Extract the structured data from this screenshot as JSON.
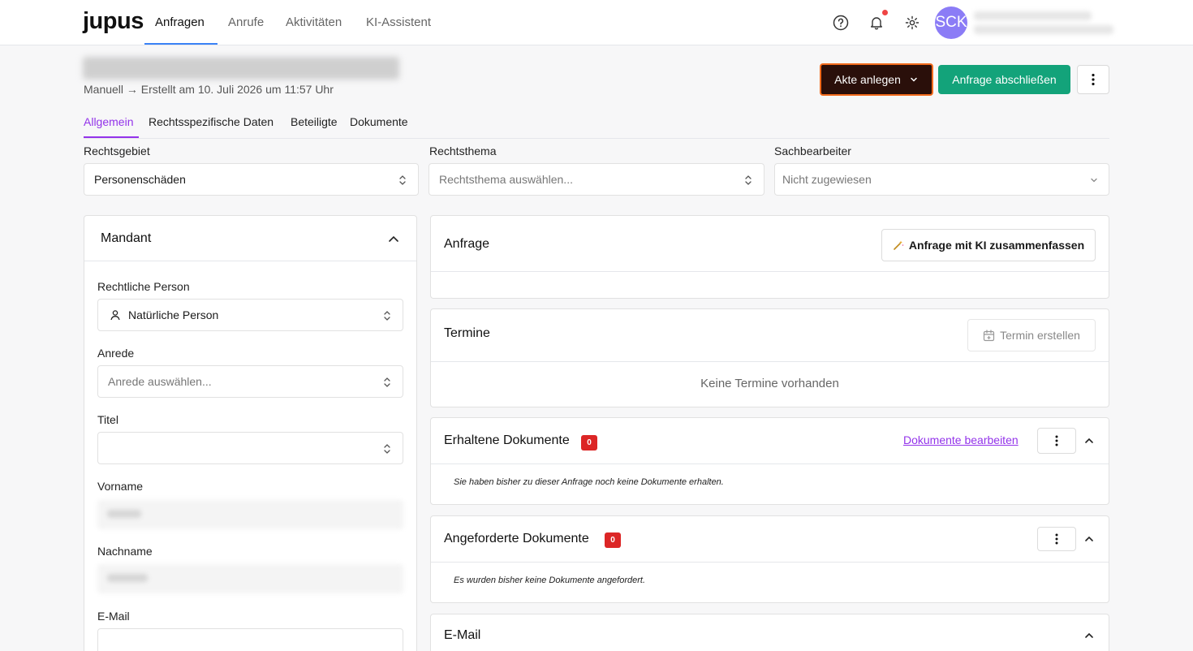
{
  "app": {
    "logo": "jupus"
  },
  "nav": {
    "items": [
      "Anfragen",
      "Anrufe",
      "Aktivitäten",
      "KI-Assistent"
    ],
    "avatar_initials": "SCK"
  },
  "header": {
    "subtitle": "Manuell → Erstellt am 10. Juli 2026 um 11:57 Uhr",
    "akte_button": "Akte anlegen",
    "finish_button": "Anfrage abschließen"
  },
  "tabs": [
    "Allgemein",
    "Rechtsspezifische Daten",
    "Beteiligte",
    "Dokumente"
  ],
  "top_fields": {
    "rechtsgebiet": {
      "label": "Rechtsgebiet",
      "value": "Personenschäden"
    },
    "rechtsthema": {
      "label": "Rechtsthema",
      "placeholder": "Rechtsthema auswählen..."
    },
    "sachbearbeiter": {
      "label": "Sachbearbeiter",
      "placeholder": "Nicht zugewiesen"
    }
  },
  "mandant": {
    "title": "Mandant",
    "rechtliche_person": {
      "label": "Rechtliche Person",
      "value": "Natürliche Person"
    },
    "anrede": {
      "label": "Anrede",
      "placeholder": "Anrede auswählen..."
    },
    "titel": {
      "label": "Titel",
      "value": ""
    },
    "vorname": {
      "label": "Vorname"
    },
    "nachname": {
      "label": "Nachname"
    },
    "email": {
      "label": "E-Mail",
      "value": ""
    }
  },
  "anfrage": {
    "title": "Anfrage",
    "summarize_button": "Anfrage mit KI zusammenfassen"
  },
  "termine": {
    "title": "Termine",
    "create_button": "Termin erstellen",
    "empty": "Keine Termine vorhanden"
  },
  "erhaltene": {
    "title": "Erhaltene Dokumente",
    "count": "0",
    "edit_link": "Dokumente bearbeiten",
    "empty": "Sie haben bisher zu dieser Anfrage noch keine Dokumente erhalten."
  },
  "angeforderte": {
    "title": "Angeforderte Dokumente",
    "count": "0",
    "empty": "Es wurden bisher keine Dokumente angefordert."
  },
  "email_panel": {
    "title": "E-Mail"
  },
  "colors": {
    "accent": "#9333ea",
    "success": "#13a37a",
    "danger": "#dc2626",
    "akte_bg": "#2a0f0a",
    "akte_border": "#f26b1d"
  }
}
